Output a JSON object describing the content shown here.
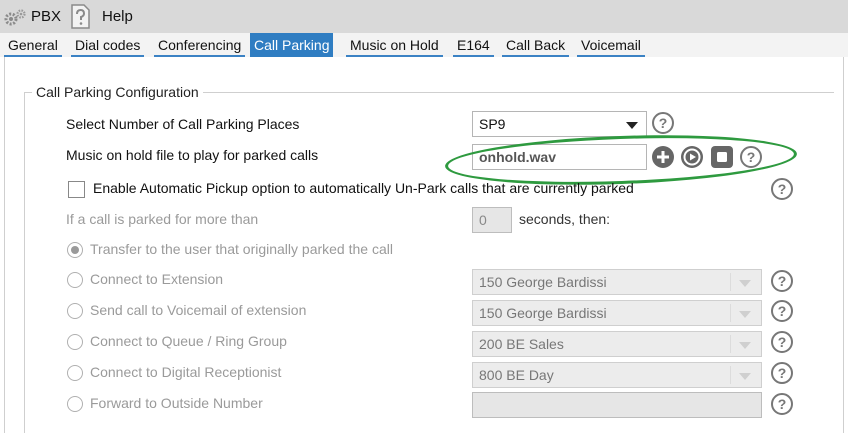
{
  "topbar": {
    "pbx_label": "PBX",
    "help_label": "Help"
  },
  "tabs": [
    {
      "label": "General"
    },
    {
      "label": "Dial codes"
    },
    {
      "label": "Conferencing"
    },
    {
      "label": "Call Parking",
      "active": true
    },
    {
      "label": "Music on Hold"
    },
    {
      "label": "E164"
    },
    {
      "label": "Call Back"
    },
    {
      "label": "Voicemail"
    }
  ],
  "section": {
    "title": "Call Parking Configuration",
    "places_label": "Select Number of Call Parking Places",
    "places_value": "SP9",
    "moh_label": "Music on hold file to play for parked calls",
    "moh_value": "onhold.wav",
    "auto_pickup_label": "Enable Automatic Pickup option to automatically Un-Park calls that are currently parked",
    "parked_more_than_label": "If a call is parked for more than",
    "seconds_value": "0",
    "seconds_then_label": "seconds, then:",
    "options": {
      "transfer": "Transfer to the user that originally parked the call",
      "connect_ext": "Connect to Extension",
      "send_vm": "Send call to Voicemail of extension",
      "connect_queue": "Connect to Queue / Ring Group",
      "connect_dr": "Connect to Digital Receptionist",
      "forward_outside": "Forward to Outside Number"
    },
    "dropdowns": {
      "connect_ext": "150 George Bardissi",
      "send_vm": "150 George Bardissi",
      "connect_queue": "200 BE Sales",
      "connect_dr": "800 BE Day"
    },
    "forward_value": ""
  },
  "help_glyph": "?",
  "colors": {
    "tab_active": "#2f7dc2",
    "highlight_ellipse": "#2e9a3f"
  }
}
